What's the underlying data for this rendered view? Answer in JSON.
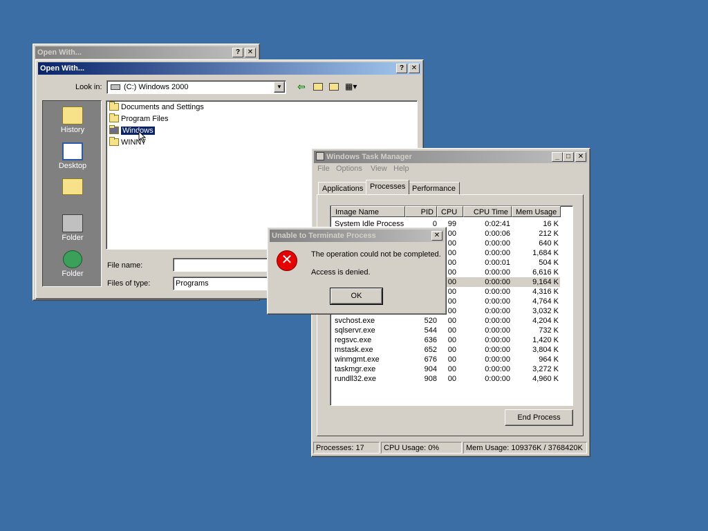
{
  "open_with_back": {
    "title": "Open With..."
  },
  "open_with": {
    "title": "Open With...",
    "look_in_label": "Look in:",
    "look_in_value": "(C:) Windows 2000",
    "places": [
      {
        "label": "History"
      },
      {
        "label": "Desktop"
      },
      {
        "label": ""
      },
      {
        "label": "Folder"
      },
      {
        "label": "Folder"
      }
    ],
    "files": [
      "Documents and Settings",
      "Program Files",
      "Windows",
      "WINNT"
    ],
    "file_name_label": "File name:",
    "file_name_value": "",
    "files_of_type_label": "Files of type:",
    "files_of_type_value": "Programs"
  },
  "task_manager": {
    "title": "Windows Task Manager",
    "menu": [
      "File",
      "Options",
      "View",
      "Help"
    ],
    "tabs": [
      "Applications",
      "Processes",
      "Performance"
    ],
    "columns": [
      "Image Name",
      "PID",
      "CPU",
      "CPU Time",
      "Mem Usage"
    ],
    "rows": [
      [
        "System Idle Process",
        "0",
        "99",
        "0:02:41",
        "16 K"
      ],
      [
        "",
        "",
        "00",
        "0:00:06",
        "212 K"
      ],
      [
        "",
        "",
        "00",
        "0:00:00",
        "640 K"
      ],
      [
        "",
        "",
        "00",
        "0:00:00",
        "1,684 K"
      ],
      [
        "",
        "",
        "00",
        "0:00:01",
        "504 K"
      ],
      [
        "",
        "",
        "00",
        "0:00:00",
        "6,616 K"
      ],
      [
        "",
        "",
        "00",
        "0:00:00",
        "9,164 K"
      ],
      [
        "",
        "",
        "00",
        "0:00:00",
        "4,316 K"
      ],
      [
        "",
        "",
        "00",
        "0:00:00",
        "4,764 K"
      ],
      [
        "",
        "",
        "00",
        "0:00:00",
        "3,032 K"
      ],
      [
        "svchost.exe",
        "520",
        "00",
        "0:00:00",
        "4,204 K"
      ],
      [
        "sqlservr.exe",
        "544",
        "00",
        "0:00:00",
        "732 K"
      ],
      [
        "regsvc.exe",
        "636",
        "00",
        "0:00:00",
        "1,420 K"
      ],
      [
        "mstask.exe",
        "652",
        "00",
        "0:00:00",
        "3,804 K"
      ],
      [
        "winmgmt.exe",
        "676",
        "00",
        "0:00:00",
        "964 K"
      ],
      [
        "taskmgr.exe",
        "904",
        "00",
        "0:00:00",
        "3,272 K"
      ],
      [
        "rundll32.exe",
        "908",
        "00",
        "0:00:00",
        "4,960 K"
      ]
    ],
    "end_process_label": "End Process",
    "status": {
      "processes": "Processes: 17",
      "cpu": "CPU Usage: 0%",
      "mem": "Mem Usage: 109376K / 3768420K"
    }
  },
  "error_dialog": {
    "title": "Unable to Terminate Process",
    "message1": "The operation could not be completed.",
    "message2": "Access is denied.",
    "ok_label": "OK"
  }
}
